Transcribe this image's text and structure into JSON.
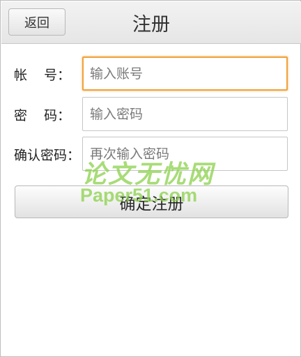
{
  "header": {
    "back_label": "返回",
    "title": "注册"
  },
  "form": {
    "account": {
      "label": "帐    号：",
      "placeholder": "输入账号",
      "value": ""
    },
    "password": {
      "label": "密    码：",
      "placeholder": "输入密码",
      "value": ""
    },
    "confirm_password": {
      "label": "确认密码：",
      "placeholder": "再次输入密码",
      "value": ""
    },
    "submit_label": "确定注册"
  },
  "watermark": {
    "line1": "论文无忧网",
    "line2": "Paper51.com"
  },
  "colors": {
    "focus_border": "#f0a23a",
    "watermark": "#8bd14a"
  }
}
